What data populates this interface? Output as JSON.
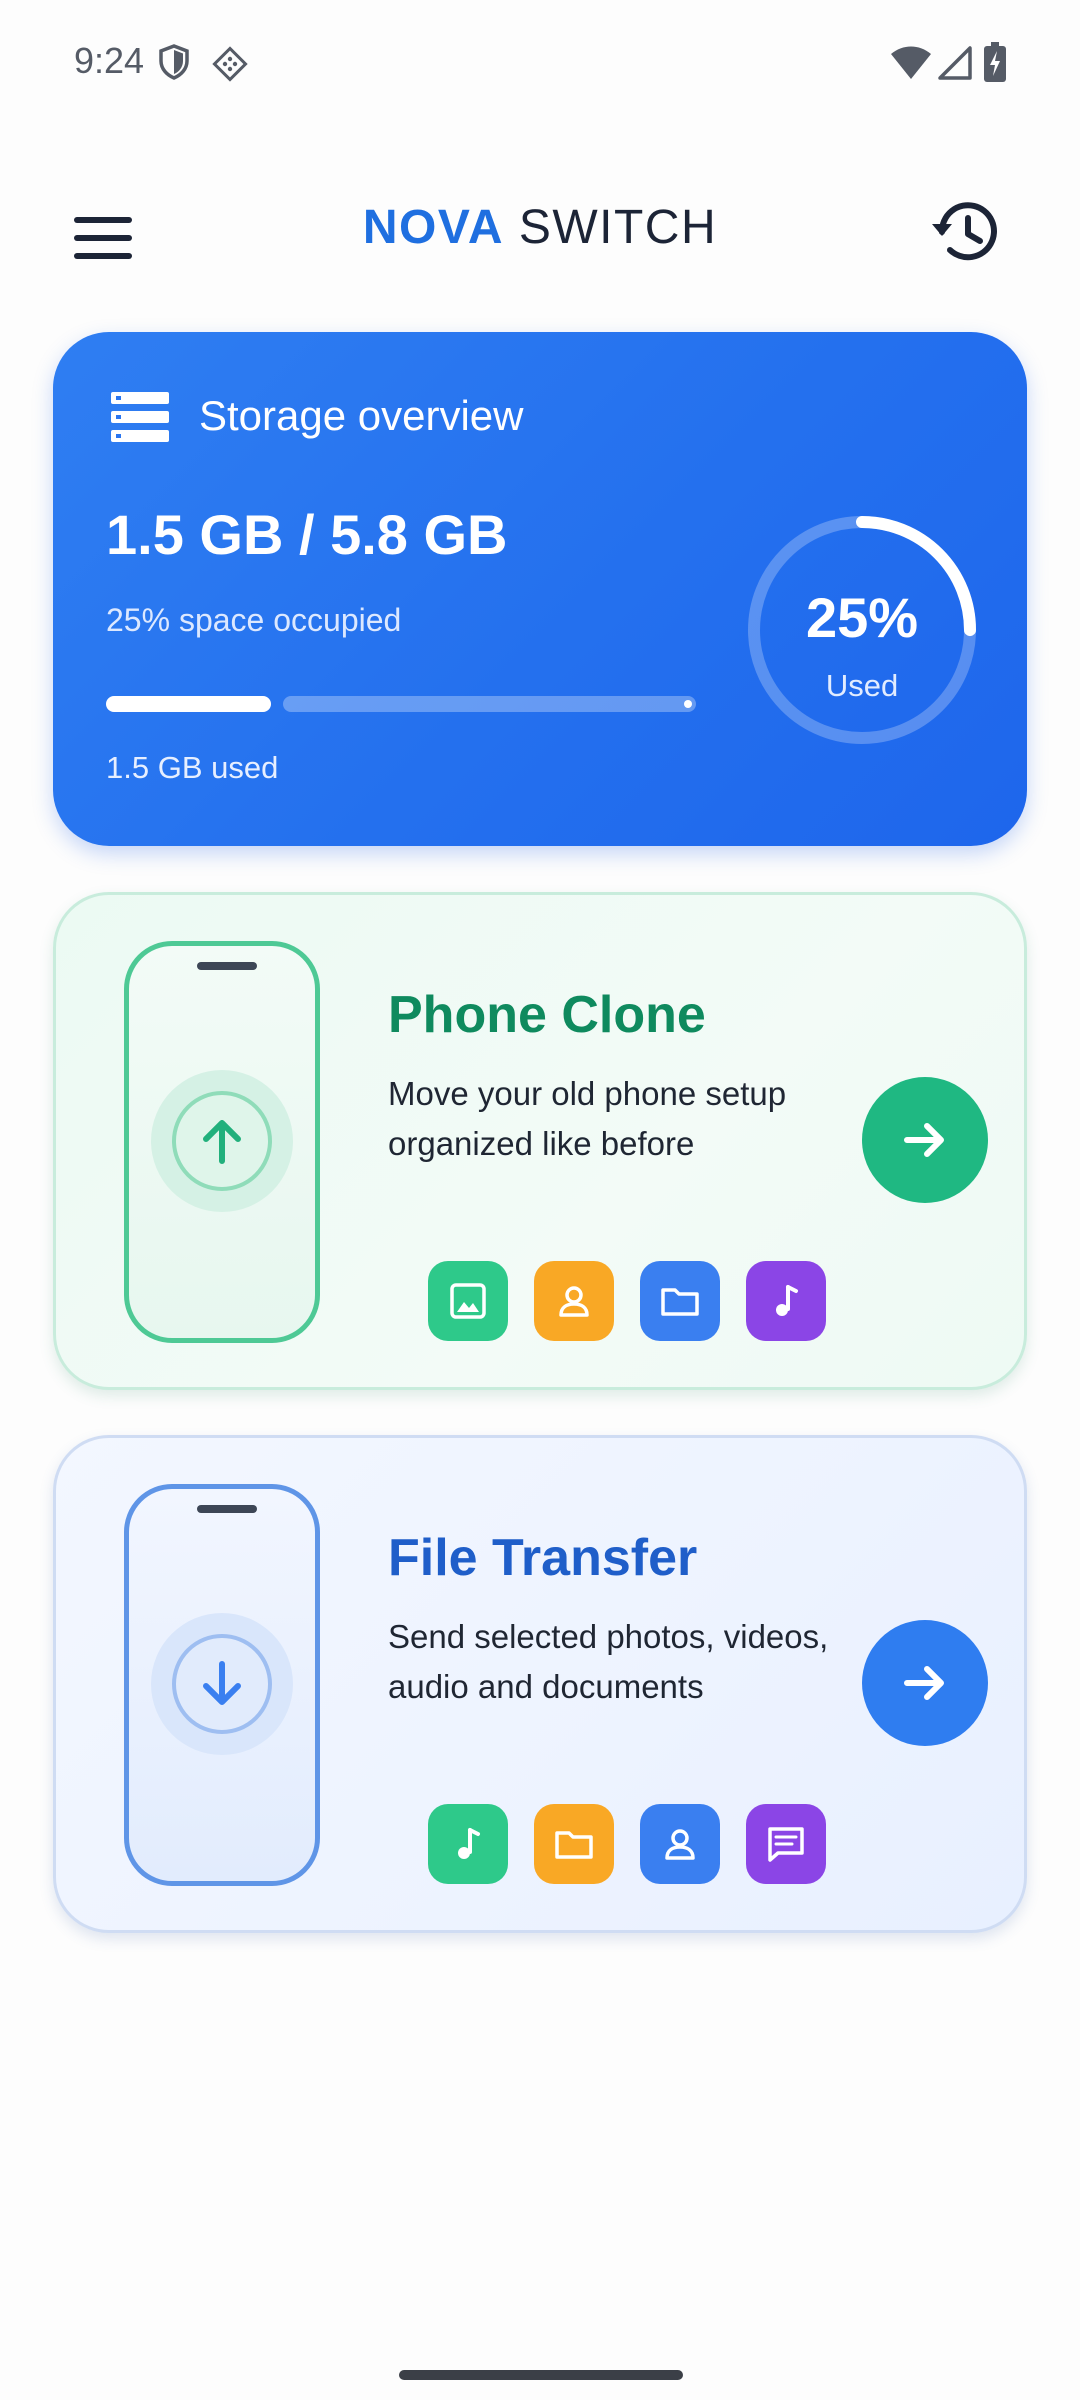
{
  "status_bar": {
    "time": "9:24",
    "left_icons": [
      "shield-icon",
      "diamond-app-icon"
    ],
    "right_icons": [
      "wifi-icon",
      "signal-icon",
      "battery-charging-icon"
    ]
  },
  "app_bar": {
    "title_part1": "NOVA",
    "title_part2": "SWITCH",
    "left_icon": "menu-icon",
    "right_icon": "history-icon"
  },
  "storage": {
    "title": "Storage overview",
    "icon": "storage-list-icon",
    "amount": "1.5 GB / 5.8 GB",
    "occupied_text": "25% space occupied",
    "used_text": "1.5 GB used",
    "progress_fraction": 0.25,
    "ring_percent": "25%",
    "ring_fraction": 0.25,
    "ring_label": "Used"
  },
  "clone": {
    "title": "Phone Clone",
    "desc_line1": "Move your old phone setup",
    "desc_line2": "organized like before",
    "arrow_icon": "upload-arrow-icon",
    "go_icon": "arrow-right-icon",
    "accent": "#1fb882",
    "chips": [
      {
        "icon": "image-icon",
        "color": "#2ec98a"
      },
      {
        "icon": "contact-icon",
        "color": "#f9a825"
      },
      {
        "icon": "folder-icon",
        "color": "#3a7ff0"
      },
      {
        "icon": "music-icon",
        "color": "#8b45e6"
      }
    ]
  },
  "transfer": {
    "title": "File Transfer",
    "desc_line1": "Send selected photos, videos,",
    "desc_line2": "audio and documents",
    "arrow_icon": "download-arrow-icon",
    "go_icon": "arrow-right-icon",
    "accent": "#2f7df0",
    "chips": [
      {
        "icon": "music-icon",
        "color": "#2ec98a"
      },
      {
        "icon": "folder-icon",
        "color": "#f9a825"
      },
      {
        "icon": "contact-icon",
        "color": "#3a7ff0"
      },
      {
        "icon": "message-icon",
        "color": "#8b45e6"
      }
    ]
  }
}
